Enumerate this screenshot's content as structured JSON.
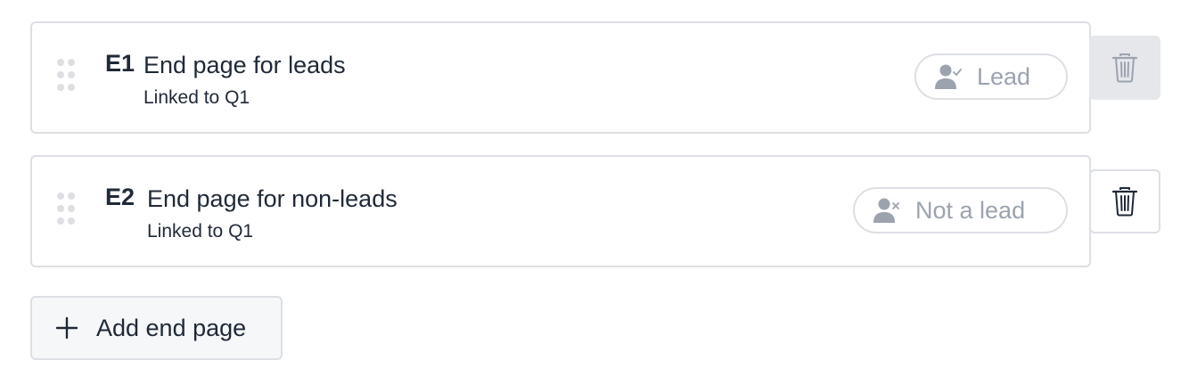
{
  "end_pages": [
    {
      "code": "E1",
      "title": "End page for leads",
      "subtitle": "Linked to Q1",
      "tag": {
        "label": "Lead",
        "icon": "person-check-icon"
      },
      "delete_enabled": false
    },
    {
      "code": "E2",
      "title": "End page for non-leads",
      "subtitle": "Linked to Q1",
      "tag": {
        "label": "Not a lead",
        "icon": "person-x-icon"
      },
      "delete_enabled": true
    }
  ],
  "add_button": {
    "label": "Add end page",
    "icon": "plus-icon"
  },
  "colors": {
    "border": "#dcdfe4",
    "text": "#1f2937",
    "muted": "#9ca3af",
    "disabled_bg": "#e5e7eb",
    "add_bg": "#f6f7f9"
  }
}
